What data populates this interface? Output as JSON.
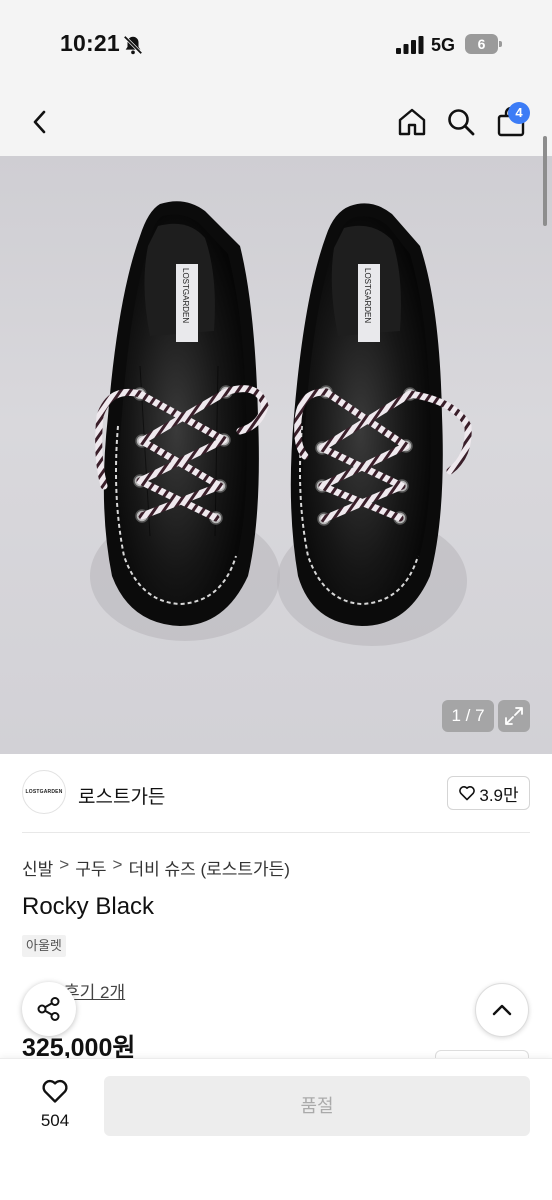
{
  "status_bar": {
    "time": "10:21",
    "network": "5G",
    "battery": "6"
  },
  "nav": {
    "cart_count": "4"
  },
  "gallery": {
    "shoe_label": "LOSTGARDEN",
    "counter": "1 / 7"
  },
  "store": {
    "logo_text": "LOSTGARDEN",
    "name": "로스트가든",
    "likes": "3.9만"
  },
  "breadcrumb": {
    "level1": "신발",
    "level2": "구두",
    "level3": "더비 슈즈 (로스트가든)",
    "separator": ">"
  },
  "product": {
    "title": "Rocky Black",
    "tag": "아울렛",
    "reviews": "후기 2개",
    "price": "325,000원"
  },
  "bottom": {
    "wish_count": "504",
    "buy_label": "품절"
  },
  "colors": {
    "accent": "#3c7cf6",
    "sold_out_bg": "#ededed",
    "sold_out_text": "#aaaaaa"
  }
}
